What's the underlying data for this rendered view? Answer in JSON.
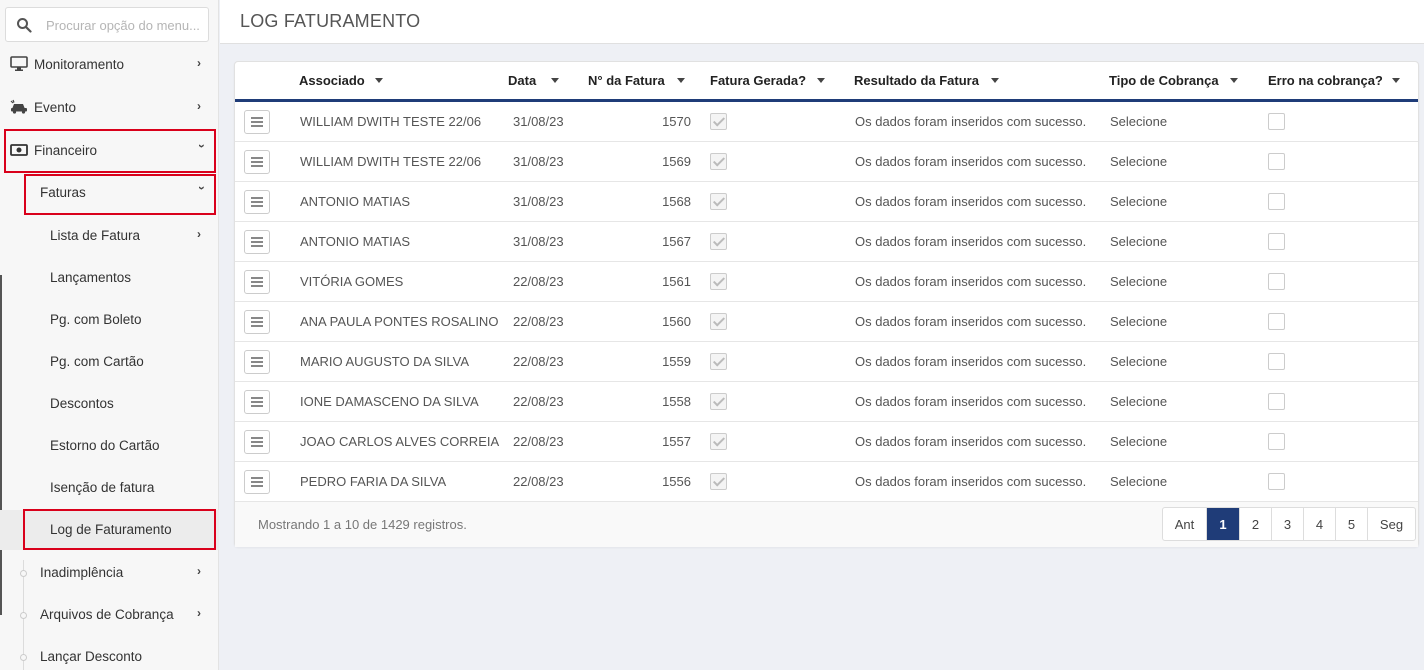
{
  "search": {
    "placeholder": "Procurar opção do menu..."
  },
  "sidebar": {
    "items": [
      {
        "label": "Monitoramento",
        "icon": "monitor-icon"
      },
      {
        "label": "Evento",
        "icon": "car-crash-icon"
      },
      {
        "label": "Financeiro",
        "icon": "money-bill-icon"
      },
      {
        "label": "Faturas"
      },
      {
        "label": "Lista de Fatura"
      },
      {
        "label": "Lançamentos"
      },
      {
        "label": "Pg. com Boleto"
      },
      {
        "label": "Pg. com Cartão"
      },
      {
        "label": "Descontos"
      },
      {
        "label": "Estorno do Cartão"
      },
      {
        "label": "Isenção de fatura"
      },
      {
        "label": "Log de Faturamento"
      },
      {
        "label": "Inadimplência"
      },
      {
        "label": "Arquivos de Cobrança"
      },
      {
        "label": "Lançar Desconto"
      }
    ]
  },
  "page": {
    "title": "LOG FATURAMENTO"
  },
  "table": {
    "headers": [
      "Associado",
      "Data",
      "N° da Fatura",
      "Fatura Gerada?",
      "Resultado da Fatura",
      "Tipo de Cobrança",
      "Erro na cobrança?"
    ],
    "rows": [
      {
        "associado": "WILLIAM DWITH TESTE 22/06",
        "data": "31/08/23",
        "fatura": "1570",
        "gerada": true,
        "resultado": "Os dados foram inseridos com sucesso.",
        "tipo": "Selecione",
        "erro": false
      },
      {
        "associado": "WILLIAM DWITH TESTE 22/06",
        "data": "31/08/23",
        "fatura": "1569",
        "gerada": true,
        "resultado": "Os dados foram inseridos com sucesso.",
        "tipo": "Selecione",
        "erro": false
      },
      {
        "associado": "ANTONIO MATIAS",
        "data": "31/08/23",
        "fatura": "1568",
        "gerada": true,
        "resultado": "Os dados foram inseridos com sucesso.",
        "tipo": "Selecione",
        "erro": false
      },
      {
        "associado": "ANTONIO MATIAS",
        "data": "31/08/23",
        "fatura": "1567",
        "gerada": true,
        "resultado": "Os dados foram inseridos com sucesso.",
        "tipo": "Selecione",
        "erro": false
      },
      {
        "associado": "VITÓRIA GOMES",
        "data": "22/08/23",
        "fatura": "1561",
        "gerada": true,
        "resultado": "Os dados foram inseridos com sucesso.",
        "tipo": "Selecione",
        "erro": false
      },
      {
        "associado": "ANA PAULA PONTES ROSALINO",
        "data": "22/08/23",
        "fatura": "1560",
        "gerada": true,
        "resultado": "Os dados foram inseridos com sucesso.",
        "tipo": "Selecione",
        "erro": false
      },
      {
        "associado": "MARIO AUGUSTO DA SILVA",
        "data": "22/08/23",
        "fatura": "1559",
        "gerada": true,
        "resultado": "Os dados foram inseridos com sucesso.",
        "tipo": "Selecione",
        "erro": false
      },
      {
        "associado": "IONE DAMASCENO DA SILVA",
        "data": "22/08/23",
        "fatura": "1558",
        "gerada": true,
        "resultado": "Os dados foram inseridos com sucesso.",
        "tipo": "Selecione",
        "erro": false
      },
      {
        "associado": "JOAO CARLOS ALVES CORREIA",
        "data": "22/08/23",
        "fatura": "1557",
        "gerada": true,
        "resultado": "Os dados foram inseridos com sucesso.",
        "tipo": "Selecione",
        "erro": false
      },
      {
        "associado": "PEDRO FARIA DA SILVA",
        "data": "22/08/23",
        "fatura": "1556",
        "gerada": true,
        "resultado": "Os dados foram inseridos com sucesso.",
        "tipo": "Selecione",
        "erro": false
      }
    ],
    "footer": "Mostrando 1 a 10 de 1429 registros."
  },
  "pagination": {
    "prev": "Ant",
    "pages": [
      "1",
      "2",
      "3",
      "4",
      "5"
    ],
    "active": "1",
    "next": "Seg"
  },
  "colors": {
    "accent": "#1f3c78",
    "highlight": "#d9001b"
  }
}
